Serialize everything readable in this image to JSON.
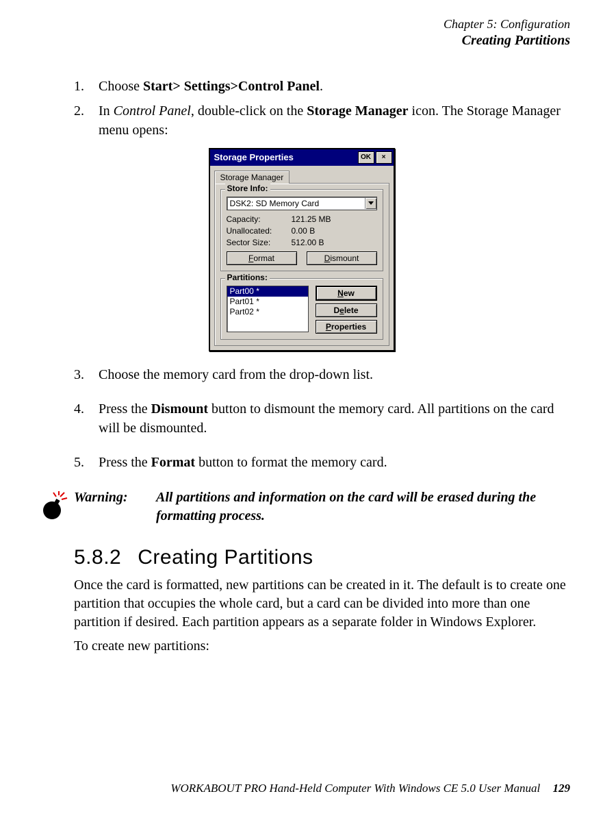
{
  "header": {
    "chapter": "Chapter 5: Configuration",
    "section": "Creating Partitions"
  },
  "steps": {
    "s1": {
      "num": "1.",
      "pre": "Choose ",
      "bold": "Start> Settings>Control Panel",
      "post": "."
    },
    "s2": {
      "num": "2.",
      "pre": "In ",
      "ital": "Control Panel",
      "mid": ", double-click on the ",
      "bold": "Storage Manager",
      "post": " icon. The Storage Manager menu opens:"
    },
    "s3": {
      "num": "3.",
      "text": "Choose the memory card from the drop-down list."
    },
    "s4": {
      "num": "4.",
      "pre": "Press the ",
      "bold": "Dismount",
      "post": " button to dismount the memory card. All partitions on the card will be dismounted."
    },
    "s5": {
      "num": "5.",
      "pre": "Press the ",
      "bold": "Format",
      "post": " button to format the memory card."
    }
  },
  "dialog": {
    "title": "Storage Properties",
    "ok": "OK",
    "close": "×",
    "tab": "Storage Manager",
    "store_group": "Store Info:",
    "combo": "DSK2: SD Memory Card",
    "capacity_label": "Capacity:",
    "capacity_value": "121.25 MB",
    "unalloc_label": "Unallocated:",
    "unalloc_value": "0.00 B",
    "sector_label": "Sector Size:",
    "sector_value": "512.00 B",
    "format_btn": {
      "u": "F",
      "rest": "ormat"
    },
    "dismount_btn": {
      "u": "D",
      "rest": "ismount"
    },
    "part_group": "Partitions:",
    "partitions": [
      "Part00 *",
      "Part01 *",
      "Part02 *"
    ],
    "new_btn": {
      "u": "N",
      "rest": "ew"
    },
    "delete_btn": {
      "pre": "D",
      "u": "e",
      "rest": "lete"
    },
    "props_btn": {
      "u": "P",
      "rest": "roperties"
    }
  },
  "warning": {
    "label": "Warning:",
    "text": "All partitions and information on the card will be erased during the formatting process."
  },
  "section582": {
    "num": "5.8.2",
    "title": "Creating Partitions",
    "p1": "Once the card is formatted, new partitions can be created in it. The default is to create one partition that occupies the whole card, but a card can be divided into more than one partition if desired. Each partition appears as a separate folder in Windows Explorer.",
    "p2": "To create new partitions:"
  },
  "footer": {
    "text": "WORKABOUT PRO Hand-Held Computer With Windows CE 5.0 User Manual",
    "page": "129"
  }
}
